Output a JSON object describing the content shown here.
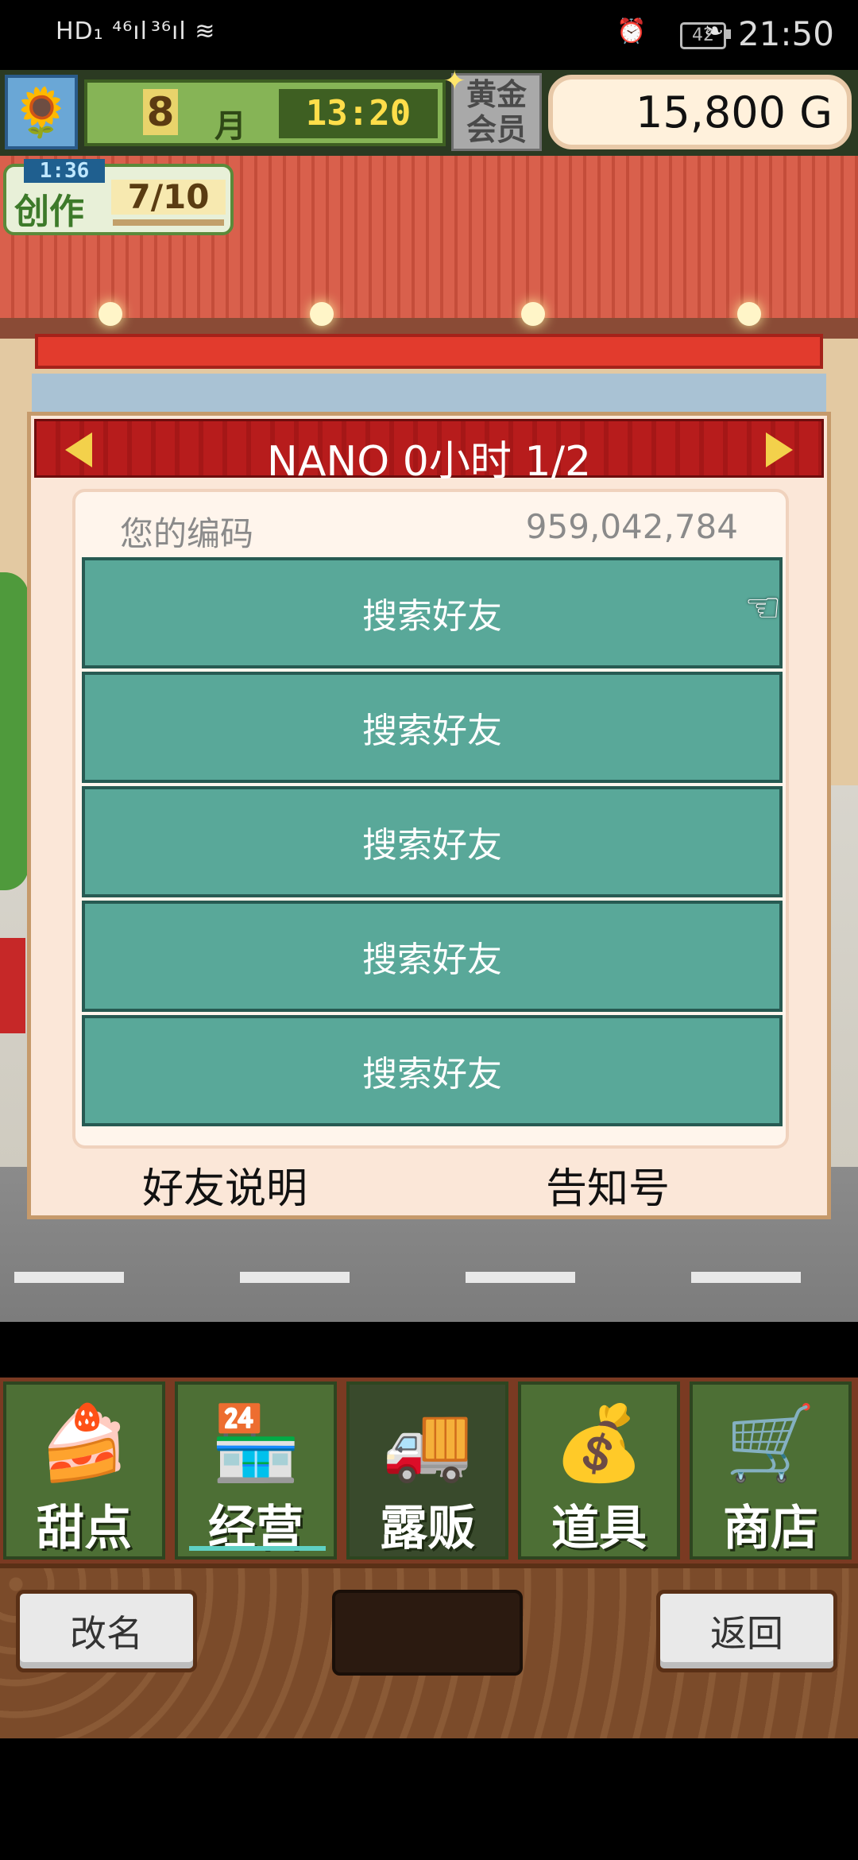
{
  "status_bar": {
    "network_left": "HD₁ ⁴⁶ıl",
    "network_right": "³⁶ıl ≋",
    "battery": "42",
    "time": "21:50"
  },
  "hud": {
    "avatar_icon": "sunflower-icon",
    "month_number": "8",
    "month_unit": "月",
    "clock": "13:20",
    "member_label": "黄金会员",
    "gold": "15,800 G"
  },
  "create": {
    "timer": "1:36",
    "label": "创作",
    "count": "7/10"
  },
  "dialog": {
    "title": "NANO  0小时 1/2",
    "code_label": "您的编码",
    "code_value": "959,042,784",
    "friend_slots": [
      "搜索好友",
      "搜索好友",
      "搜索好友",
      "搜索好友",
      "搜索好友"
    ],
    "friend_help": "好友说明",
    "notice_id": "告知号"
  },
  "menu": {
    "items": [
      {
        "label": "甜点",
        "icon": "cake-icon"
      },
      {
        "label": "经营",
        "icon": "shop-icon"
      },
      {
        "label": "露贩",
        "icon": "truck-icon"
      },
      {
        "label": "道具",
        "icon": "bag-icon"
      },
      {
        "label": "商店",
        "icon": "cart-icon"
      }
    ],
    "selected": "露贩"
  },
  "actions": {
    "rename": "改名",
    "back": "返回"
  }
}
